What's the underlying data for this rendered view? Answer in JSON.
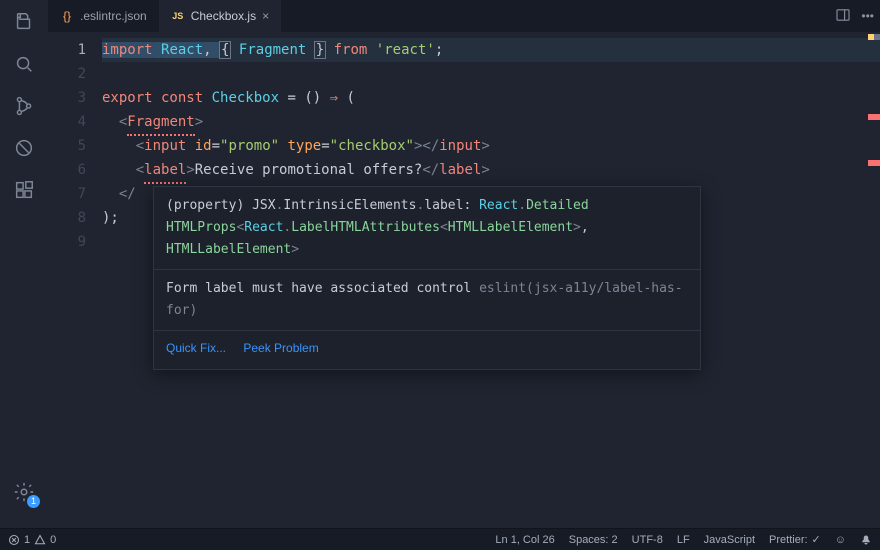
{
  "tabs": {
    "inactive": {
      "icon": "{}",
      "label": ".eslintrc.json"
    },
    "active": {
      "icon": "JS",
      "label": "Checkbox.js",
      "close": "×"
    }
  },
  "gutter": [
    "1",
    "2",
    "3",
    "4",
    "5",
    "6",
    "7",
    "8",
    "9"
  ],
  "code": {
    "l1": {
      "import": "import",
      "React": "React",
      "c1": ", ",
      "lb": "{",
      "sp1": " ",
      "Frag": "Fragment",
      "sp2": " ",
      "rb": "}",
      "from": " from ",
      "q": "'react'",
      "semi": ";"
    },
    "l3": {
      "export": "export",
      "const": " const ",
      "name": "Checkbox",
      "eq": " = () ",
      "arrow": "⇒",
      "open": " ("
    },
    "l4": {
      "ind": "  ",
      "lt": "<",
      "Frag": "Fragment",
      "gt": ">"
    },
    "l5": {
      "ind": "    ",
      "lt": "<",
      "input": "input",
      "idk": " id",
      "eq1": "=",
      "idv": "\"promo\"",
      "tyk": " type",
      "eq2": "=",
      "tyv": "\"checkbox\"",
      "gt": ">",
      "lt2": "</",
      "input2": "input",
      "gt2": ">"
    },
    "l6": {
      "ind": "    ",
      "lt": "<",
      "label": "label",
      "gt": ">",
      "txt": "Receive promotional offers?",
      "lt2": "</",
      "label2": "label",
      "gt2": ">"
    },
    "l7": {
      "ind": "  ",
      "lt": "</"
    },
    "l8": {
      "close": ");"
    }
  },
  "hover": {
    "sig_a": "(property) JSX",
    "dot1": ".",
    "sig_b": "IntrinsicElements",
    "dot2": ".",
    "sig_c": "label",
    "colon": ": ",
    "sig_d": "React",
    "dot3": ".",
    "sig_e": "Detailed",
    "sig_f": "HTMLProps",
    "lt1": "<",
    "sig_g": "React",
    "dot4": ".",
    "sig_h": "LabelHTMLAttributes",
    "lt2": "<",
    "sig_i": "HTMLLabelElement",
    "gt1": ">",
    ",": ",",
    "sig_j": " HTMLLabelElement",
    "gt2": ">",
    "msg": "Form label must have associated control ",
    "rule": "eslint(jsx-a11y/label-has-for)",
    "quickfix": "Quick Fix...",
    "peek": "Peek Problem"
  },
  "status": {
    "errors": "1",
    "warnings": "0",
    "lncol": "Ln 1, Col 26",
    "spaces": "Spaces: 2",
    "enc": "UTF-8",
    "eol": "LF",
    "lang": "JavaScript",
    "prettier": "Prettier: ",
    "check": "✓",
    "feedback": "☺",
    "bell": "bell",
    "badge": "1"
  }
}
